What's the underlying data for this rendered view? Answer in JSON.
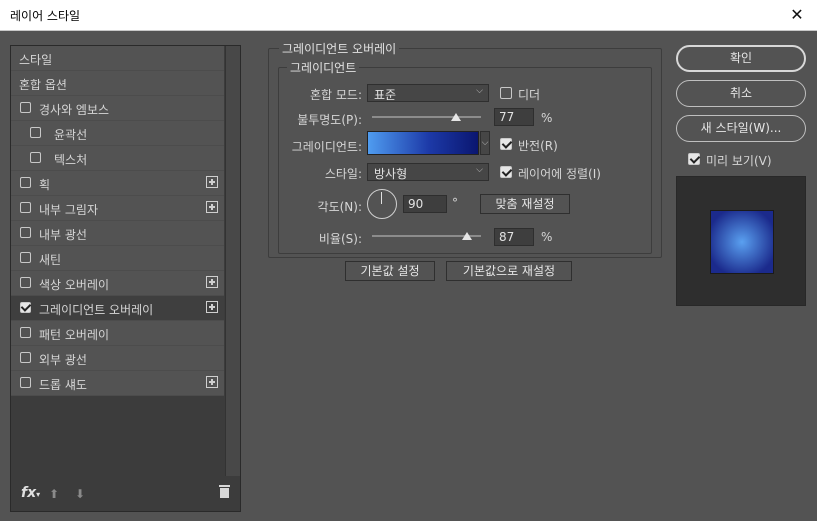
{
  "window": {
    "title": "레이어 스타일",
    "close_glyph": "✕"
  },
  "sidebar": {
    "items": [
      {
        "label": "스타일",
        "checkbox": false,
        "checked": false,
        "plus": false,
        "indent": false,
        "selected": false
      },
      {
        "label": "혼합 옵션",
        "checkbox": false,
        "checked": false,
        "plus": false,
        "indent": false,
        "selected": false
      },
      {
        "label": "경사와 엠보스",
        "checkbox": true,
        "checked": false,
        "plus": false,
        "indent": false,
        "selected": false
      },
      {
        "label": "윤곽선",
        "checkbox": true,
        "checked": false,
        "plus": false,
        "indent": true,
        "selected": false
      },
      {
        "label": "텍스처",
        "checkbox": true,
        "checked": false,
        "plus": false,
        "indent": true,
        "selected": false
      },
      {
        "label": "획",
        "checkbox": true,
        "checked": false,
        "plus": true,
        "indent": false,
        "selected": false
      },
      {
        "label": "내부 그림자",
        "checkbox": true,
        "checked": false,
        "plus": true,
        "indent": false,
        "selected": false
      },
      {
        "label": "내부 광선",
        "checkbox": true,
        "checked": false,
        "plus": false,
        "indent": false,
        "selected": false
      },
      {
        "label": "새틴",
        "checkbox": true,
        "checked": false,
        "plus": false,
        "indent": false,
        "selected": false
      },
      {
        "label": "색상 오버레이",
        "checkbox": true,
        "checked": false,
        "plus": true,
        "indent": false,
        "selected": false
      },
      {
        "label": "그레이디언트 오버레이",
        "checkbox": true,
        "checked": true,
        "plus": true,
        "indent": false,
        "selected": true
      },
      {
        "label": "패턴 오버레이",
        "checkbox": true,
        "checked": false,
        "plus": false,
        "indent": false,
        "selected": false
      },
      {
        "label": "외부 광선",
        "checkbox": true,
        "checked": false,
        "plus": false,
        "indent": false,
        "selected": false
      },
      {
        "label": "드롭 섀도",
        "checkbox": true,
        "checked": false,
        "plus": true,
        "indent": false,
        "selected": false
      }
    ],
    "footer": {
      "fx_label": "fx",
      "fx_suffix": "▾",
      "up_glyph": "⬆",
      "down_glyph": "⬇"
    }
  },
  "panel": {
    "group_title": "그레이디언트 오버레이",
    "subgroup_title": "그레이디언트",
    "blend_mode_label": "혼합 모드:",
    "blend_mode_value": "표준",
    "dither_label": "디더",
    "dither_checked": false,
    "opacity_label": "불투명도(P):",
    "opacity_value": "77",
    "opacity_fraction": 0.77,
    "opacity_unit": "%",
    "gradient_label": "그레이디언트:",
    "reverse_label": "반전(R)",
    "reverse_checked": true,
    "style_label": "스타일:",
    "style_value": "방사형",
    "align_label": "레이어에 정렬(I)",
    "align_checked": true,
    "angle_label": "각도(N):",
    "angle_value": "90",
    "angle_unit": "°",
    "reset_align_label": "맞춤 재설정",
    "scale_label": "비율(S):",
    "scale_value": "87",
    "scale_fraction": 0.87,
    "scale_unit": "%",
    "make_default_label": "기본값 설정",
    "reset_default_label": "기본값으로 재설정",
    "gradient_colors": [
      "#4f9cf0",
      "#1d3aa8",
      "#0a1670"
    ],
    "dropdown_glyph": "⌵"
  },
  "actions": {
    "ok_label": "확인",
    "cancel_label": "취소",
    "new_style_label": "새 스타일(W)...",
    "preview_label": "미리 보기(V)",
    "preview_checked": true
  },
  "preview": {
    "center_color": "#5aa0f0",
    "edge_color": "#1b2a8c"
  }
}
